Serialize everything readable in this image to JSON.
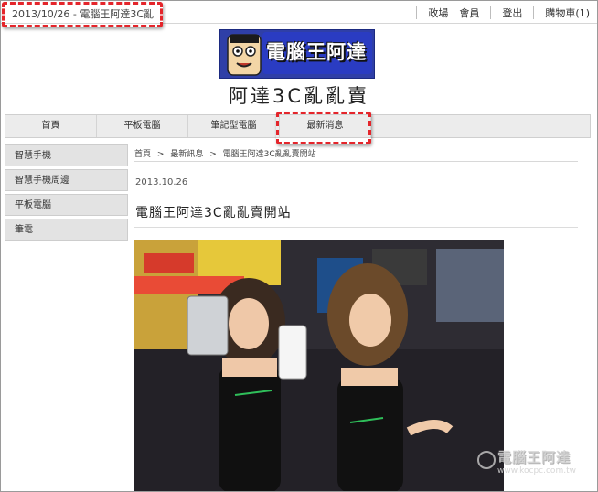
{
  "topbar": {
    "date_title": "2013/10/26 - 電腦王阿達3C亂",
    "links": [
      "政場",
      "會員",
      "登出",
      "購物車(1)"
    ]
  },
  "logo": {
    "text": "電腦王阿達"
  },
  "site_title": "阿達3C亂亂賣",
  "nav": [
    "首頁",
    "平板電腦",
    "筆記型電腦",
    "最新消息"
  ],
  "sidebar": [
    "智慧手機",
    "智慧手機周邊",
    "平板電腦",
    "筆電"
  ],
  "breadcrumb": [
    "首頁",
    ">",
    "最新訊息",
    ">",
    "電腦王阿達3C亂亂賣開站"
  ],
  "post": {
    "date": "2013.10.26",
    "title": "電腦王阿達3C亂亂賣開站"
  },
  "watermark": {
    "text": "電腦王阿達",
    "url": "www.kocpc.com.tw"
  },
  "colors": {
    "highlight": "#e4252b",
    "logo_bg": "#2f3fa7",
    "nav_bg": "#ececec",
    "sidebar_bg": "#e3e3e3"
  }
}
